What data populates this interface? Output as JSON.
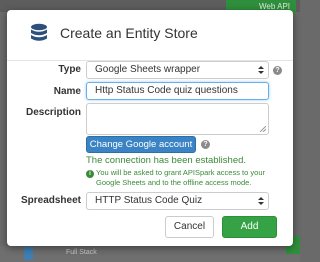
{
  "background": {
    "top_badge": "Web API",
    "bottom_label": "Full Stack"
  },
  "dialog": {
    "title": "Create an Entity Store",
    "icon": "database-icon",
    "type": {
      "label": "Type",
      "value": "Google Sheets wrapper"
    },
    "name": {
      "label": "Name",
      "value": "Http Status Code quiz questions"
    },
    "description": {
      "label": "Description",
      "value": ""
    },
    "google_button": "Change Google account",
    "connection_status": "The connection has been established.",
    "info_text": "You will be asked to grant APISpark access to your Google Sheets and to the offline access mode.",
    "spreadsheet": {
      "label": "Spreadsheet",
      "value": "HTTP Status Code Quiz"
    },
    "cancel_label": "Cancel",
    "add_label": "Add",
    "help_glyph": "?",
    "info_glyph": "i"
  },
  "colors": {
    "primary_button": "#3a83c4",
    "success_button": "#35a345",
    "success_text": "#3a8a3a"
  }
}
